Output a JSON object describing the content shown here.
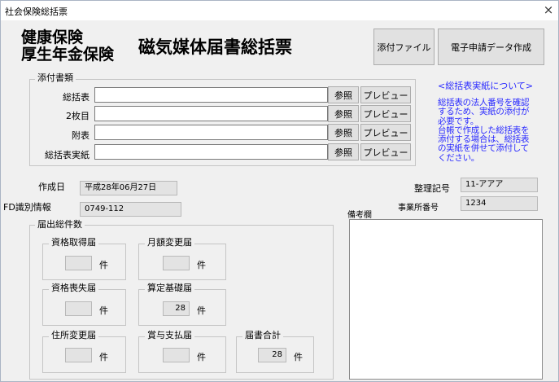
{
  "window": {
    "title": "社会保険総括票",
    "close_glyph": "×"
  },
  "header": {
    "line1": "健康保険",
    "line2": "厚生年金保険",
    "doc_title": "磁気媒体届書総括票"
  },
  "top_buttons": {
    "attach": "添付ファイル",
    "create": "電子申請データ作成"
  },
  "attachments": {
    "legend": "添付書類",
    "rows": [
      {
        "label": "総括表",
        "value": "",
        "browse": "参照",
        "preview": "プレビュー"
      },
      {
        "label": "2枚目",
        "value": "",
        "browse": "参照",
        "preview": "プレビュー"
      },
      {
        "label": "附表",
        "value": "",
        "browse": "参照",
        "preview": "プレビュー"
      },
      {
        "label": "総括表実紙",
        "value": "",
        "browse": "参照",
        "preview": "プレビュー"
      }
    ]
  },
  "note": {
    "link": "<総括表実紙について>",
    "lines": [
      "総括表の法人番号を確認",
      "するため、実紙の添付が",
      "必要です。",
      "台帳で作成した総括表を",
      "添付する場合は、総括表",
      "の実紙を併せて添付して",
      "ください。"
    ]
  },
  "info": {
    "created_label": "作成日",
    "created_value": "平成28年06月27日",
    "fd_label": "FD識別情報",
    "fd_value": "0749-112",
    "ref_label": "整理記号",
    "ref_value": "11-アアア",
    "office_label": "事業所番号",
    "office_value": "1234",
    "remarks_label": "備考欄",
    "remarks_value": ""
  },
  "counts": {
    "legend": "届出総件数",
    "unit": "件",
    "groups": [
      {
        "label": "資格取得届",
        "value": ""
      },
      {
        "label": "月額変更届",
        "value": ""
      },
      {
        "label": "資格喪失届",
        "value": ""
      },
      {
        "label": "算定基礎届",
        "value": "28"
      },
      {
        "label": "住所変更届",
        "value": ""
      },
      {
        "label": "賞与支払届",
        "value": ""
      },
      {
        "label": "届書合計",
        "value": "28"
      }
    ]
  }
}
